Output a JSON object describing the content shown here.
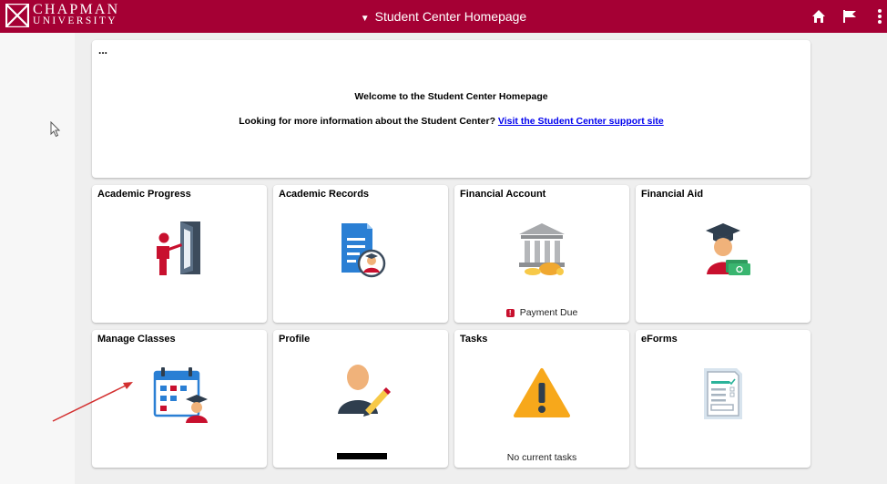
{
  "header": {
    "logo_line1": "CHAPMAN",
    "logo_line2": "UNIVERSITY",
    "title": "Student Center Homepage",
    "colors": {
      "bar": "#a50034",
      "text": "#ffffff"
    }
  },
  "banner": {
    "dots": "...",
    "welcome": "Welcome to the Student Center Homepage",
    "info_text": "Looking for more information about the Student Center?",
    "link_text": "Visit the Student Center support site"
  },
  "tiles": [
    {
      "title": "Academic Progress",
      "icon": "door-person-icon"
    },
    {
      "title": "Academic Records",
      "icon": "document-graduate-icon"
    },
    {
      "title": "Financial Account",
      "icon": "bank-piggy-icon",
      "footer": "Payment Due"
    },
    {
      "title": "Financial Aid",
      "icon": "graduate-money-icon"
    },
    {
      "title": "Manage Classes",
      "icon": "calendar-graduate-icon"
    },
    {
      "title": "Profile",
      "icon": "person-pencil-icon"
    },
    {
      "title": "Tasks",
      "icon": "warning-icon",
      "footer": "No current tasks"
    },
    {
      "title": "eForms",
      "icon": "form-checklist-icon"
    }
  ]
}
